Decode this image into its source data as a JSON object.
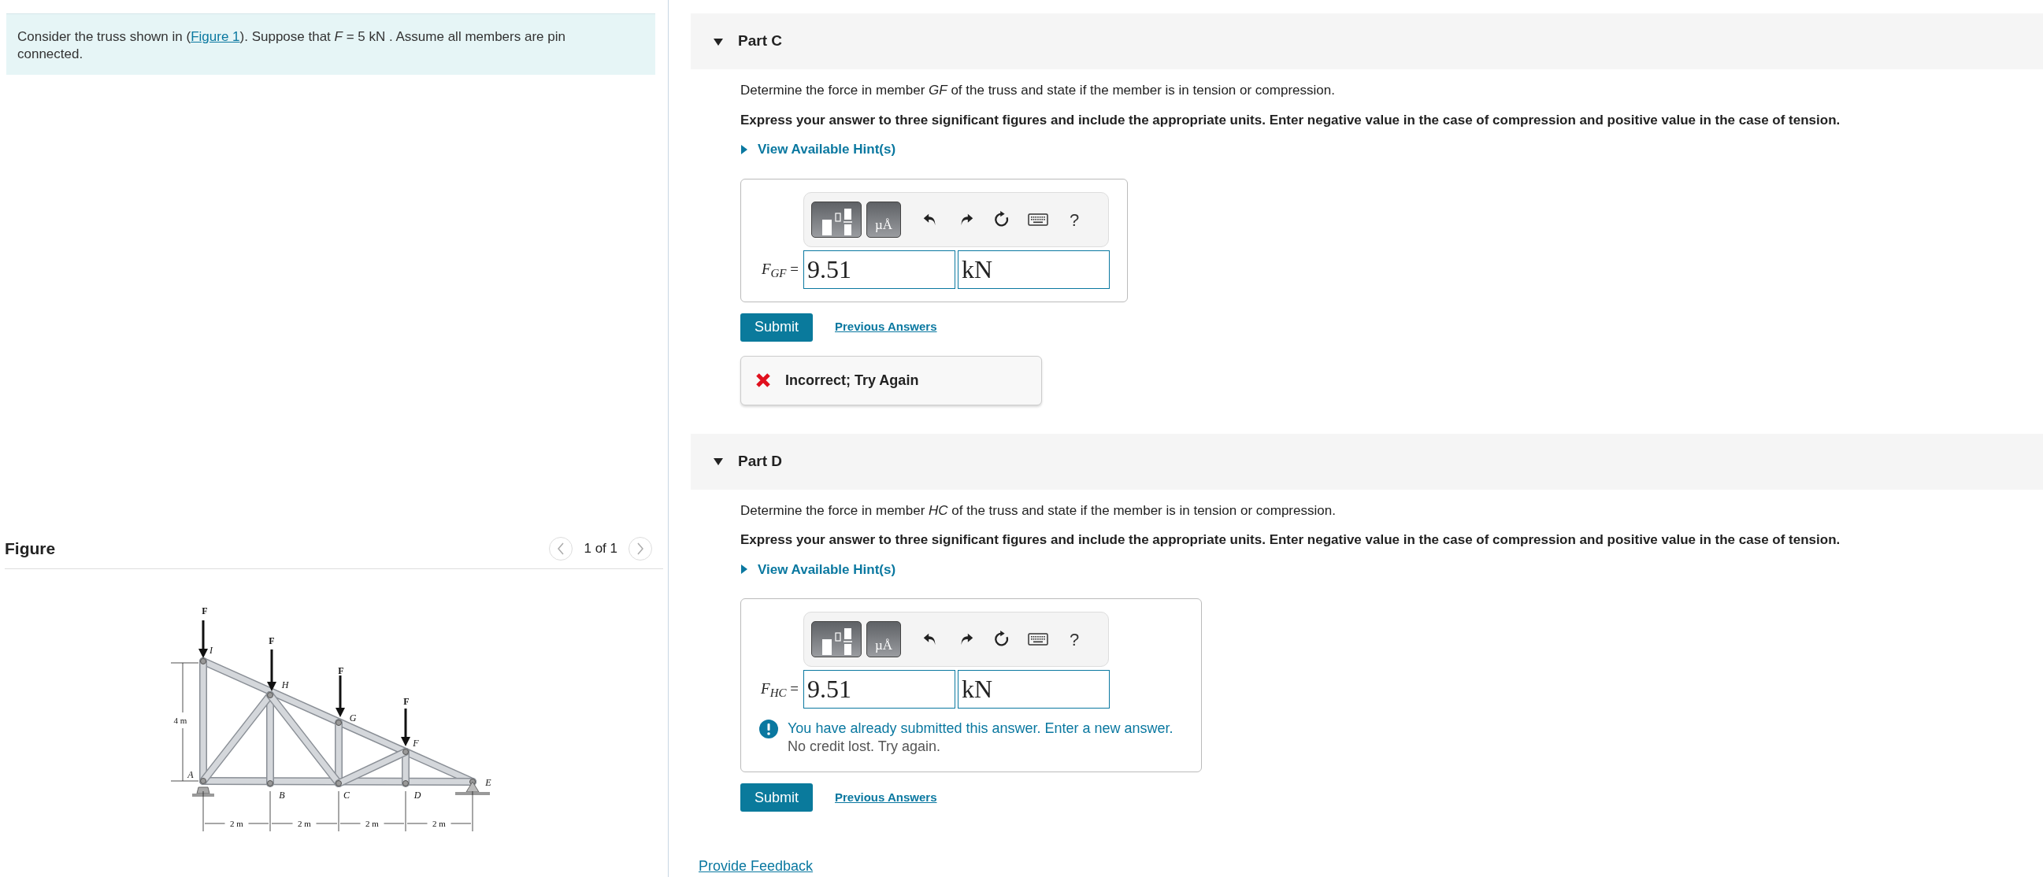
{
  "intro": {
    "text_before": "Consider the truss shown in (",
    "link": "Figure 1",
    "text_after": "). Suppose that *F* = 5 kN . Assume all members are pin connected."
  },
  "figure": {
    "heading": "Figure",
    "pager": "1 of 1",
    "forces": [
      "F",
      "F",
      "F",
      "F"
    ],
    "joints": [
      "I",
      "H",
      "G",
      "F",
      "A",
      "B",
      "C",
      "D",
      "E"
    ],
    "height_dim": "4 m",
    "spans": [
      "2 m",
      "2 m",
      "2 m",
      "2 m"
    ]
  },
  "parts": [
    {
      "title": "Part C",
      "expanded": true,
      "question": "Determine the force in member *GF* of the truss and state if the member is in tension or compression.",
      "instruction": "Express your answer to three significant figures and include the appropriate units. Enter negative value in the case of compression and positive value in the case of tension.",
      "hint": {
        "label": "View Available Hint(s)",
        "expanded": false
      },
      "toolbar": {
        "units_label": "µÅ",
        "help_label": "?"
      },
      "answer": {
        "label": "*F*$_{GF}$ =",
        "value": "9.51",
        "units": "kN"
      },
      "submit": "Submit",
      "previous": "Previous Answers",
      "feedback": {
        "kind": "incorrect",
        "text": "Incorrect; Try Again"
      }
    },
    {
      "title": "Part D",
      "expanded": true,
      "question": "Determine the force in member *HC* of the truss and state if the member is in tension or compression.",
      "instruction": "Express your answer to three significant figures and include the appropriate units. Enter negative value in the case of compression and positive value in the case of tension.",
      "hint": {
        "label": "View Available Hint(s)",
        "expanded": false
      },
      "toolbar": {
        "units_label": "µÅ",
        "help_label": "?"
      },
      "answer": {
        "label": "*F*$_{HC}$ =",
        "value": "9.51",
        "units": "kN"
      },
      "submit": "Submit",
      "previous": "Previous Answers",
      "feedback": {
        "kind": "already_submitted",
        "text": "You have already submitted this answer. Enter a new answer.",
        "subtext": "No credit lost. Try again."
      }
    }
  ],
  "footer_link": "Provide Feedback"
}
